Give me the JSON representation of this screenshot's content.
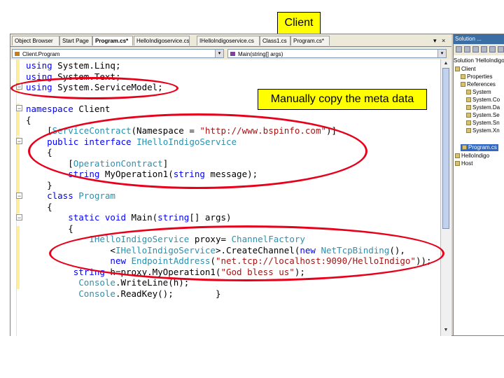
{
  "callouts": {
    "client": "Client",
    "manual_copy": "Manually copy the meta data"
  },
  "tabs": [
    {
      "label": "Object Browser"
    },
    {
      "label": "Start Page"
    },
    {
      "label": "Program.cs*"
    },
    {
      "label": "HelloIndigoservice.cs"
    },
    {
      "label": "IHelloIndigoservice.cs"
    },
    {
      "label": "Class1.cs"
    },
    {
      "label": "Program.cs*"
    }
  ],
  "tab_controls": {
    "dropdown": "▾",
    "close": "×"
  },
  "nav": {
    "class_combo": "Client.Program",
    "member_combo": "Main(string[] args)",
    "arrow": "▾"
  },
  "code": {
    "l1": {
      "kw": "using",
      "rest": " System.Linq;"
    },
    "l2": {
      "kw": "using",
      "rest": " System.Text;"
    },
    "l3": {
      "kw": "using",
      "rest": " System.ServiceModel;"
    },
    "l4": {
      "kw": "namespace",
      "rest": " Client"
    },
    "l5": "{",
    "l6": {
      "pre": "[",
      "attr": "ServiceContract",
      "mid": "(Namespace = ",
      "str": "\"http://www.bspinfo.com\"",
      "post": ")]"
    },
    "l7": {
      "kw1": "public",
      "kw2": "interface",
      "type": "IHelloIndigoService"
    },
    "l8": "{",
    "l9": {
      "pre": "[",
      "attr": "OperationContract",
      "post": "]"
    },
    "l10": {
      "kw": "string",
      "rest": " MyOperation1(",
      "kw2": "string",
      "rest2": " message);"
    },
    "l11": "}",
    "l12": {
      "kw": "class",
      "type": "Program"
    },
    "l13": "{",
    "l14": {
      "kw1": "static",
      "kw2": "void",
      "rest": " Main(",
      "kw3": "string",
      "rest2": "[] args)"
    },
    "l15": "{",
    "l16": {
      "type": "IHelloIndigoService",
      "rest": " proxy= ",
      "type2": "ChannelFactory"
    },
    "l17": {
      "pre": "<",
      "type": "IHelloIndigoService",
      "rest": ">.CreateChannel(",
      "kw": "new",
      "type2": "NetTcpBinding",
      "post": "(),"
    },
    "l18": {
      "kw": "new",
      "type": "EndpointAddress",
      "pre": "(",
      "str": "\"net.tcp://localhost:9090/HelloIndigo\"",
      "post": "));"
    },
    "l19": {
      "kw": "string",
      "rest": " h=proxy.MyOperation1(",
      "str": "\"God bless us\"",
      "post": ");"
    },
    "l20": {
      "type": "Console",
      "rest": ".WriteLine(h);"
    },
    "l21": {
      "type": "Console",
      "rest": ".ReadKey();"
    },
    "l22": "}"
  },
  "solution": {
    "title": "Solution ...",
    "header": "Solution 'HelloIndigo' (3",
    "items": [
      "Client",
      "Properties",
      "References",
      "System",
      "System.Co",
      "System.Da",
      "System.Se",
      "System.Sn",
      "System.Xn",
      "Program.cs",
      "HelloIndigo",
      "Host"
    ]
  },
  "colors": {
    "highlight": "#ffff00",
    "ellipse": "#e8001a",
    "keyword": "#0000ff",
    "type": "#2b91af",
    "string": "#a31515"
  }
}
